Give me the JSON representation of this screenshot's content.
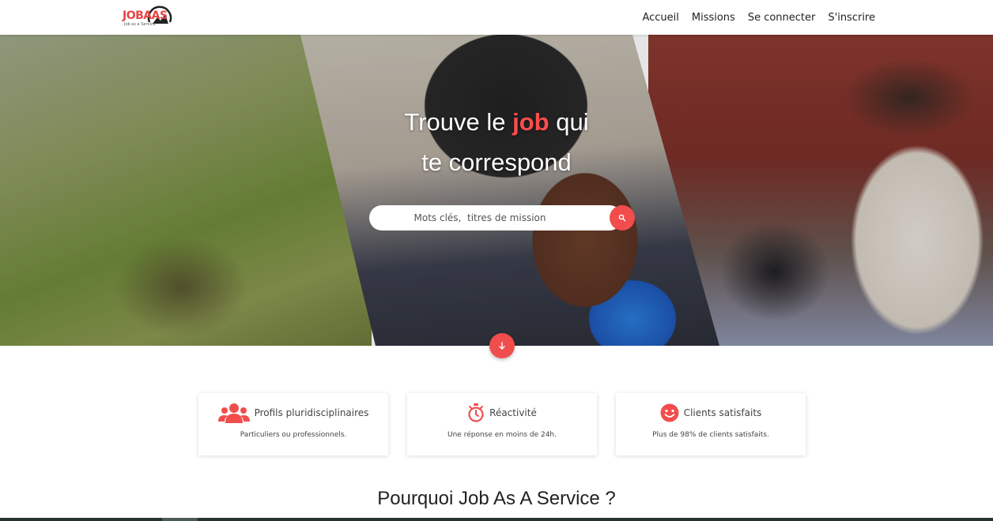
{
  "brand": {
    "logo_text": "JOBAAS",
    "tagline": "Job as a Service"
  },
  "nav": {
    "items": [
      "Accueil",
      "Missions",
      "Se connecter",
      "S'inscrire"
    ]
  },
  "hero": {
    "title_part1": "Trouve le ",
    "title_accent": "job",
    "title_part2": " qui",
    "title_line2": "te correspond",
    "search_placeholder": "Mots clés,  titres de mission"
  },
  "icons": {
    "search": "search-icon",
    "scroll": "arrow-down-icon",
    "profiles": "users-icon",
    "reactivity": "stopwatch-icon",
    "clients": "smile-icon"
  },
  "features": [
    {
      "title": "Profils pluridisciplinaires",
      "desc": "Particuliers ou professionnels."
    },
    {
      "title": "Réactivité",
      "desc": "Une réponse en moins de 24h."
    },
    {
      "title": "Clients satisfaits",
      "desc": "Plus de 98% de clients satisfaits."
    }
  ],
  "section": {
    "title": "Pourquoi Job As A Service ?"
  },
  "colors": {
    "accent": "#f24d4d",
    "text": "#222222"
  }
}
